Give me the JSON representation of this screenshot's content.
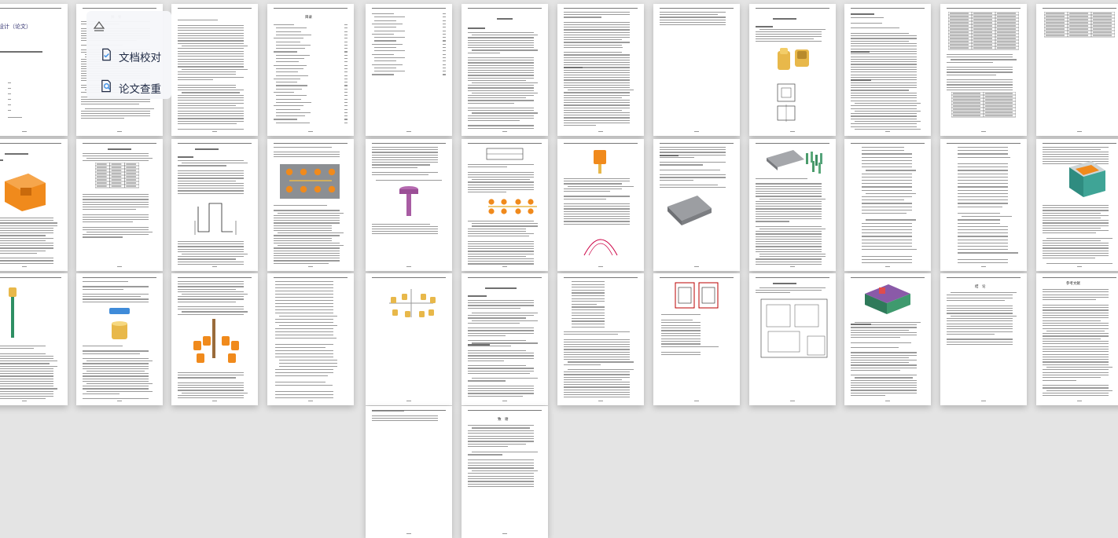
{
  "cover": {
    "title": "毕业设计（论文）"
  },
  "abstract_page": {
    "title": "摘　要"
  },
  "toc_page": {
    "title": "目录"
  },
  "conclusion_page": {
    "title": "结　论"
  },
  "references_page": {
    "title": "参考文献"
  },
  "thanks_page": {
    "title": "致　谢"
  },
  "badges": [
    {
      "label": "文档校对",
      "icon": "document-check-icon"
    },
    {
      "label": "论文查重",
      "icon": "search-document-icon"
    }
  ],
  "colors": {
    "background": "#e4e4e4",
    "page": "#ffffff",
    "model_orange": "#f08a1c",
    "model_yellow": "#e8b84a",
    "model_gray": "#8c8f93",
    "model_teal": "#3a9d8f",
    "badge_text": "#1f2a44"
  }
}
